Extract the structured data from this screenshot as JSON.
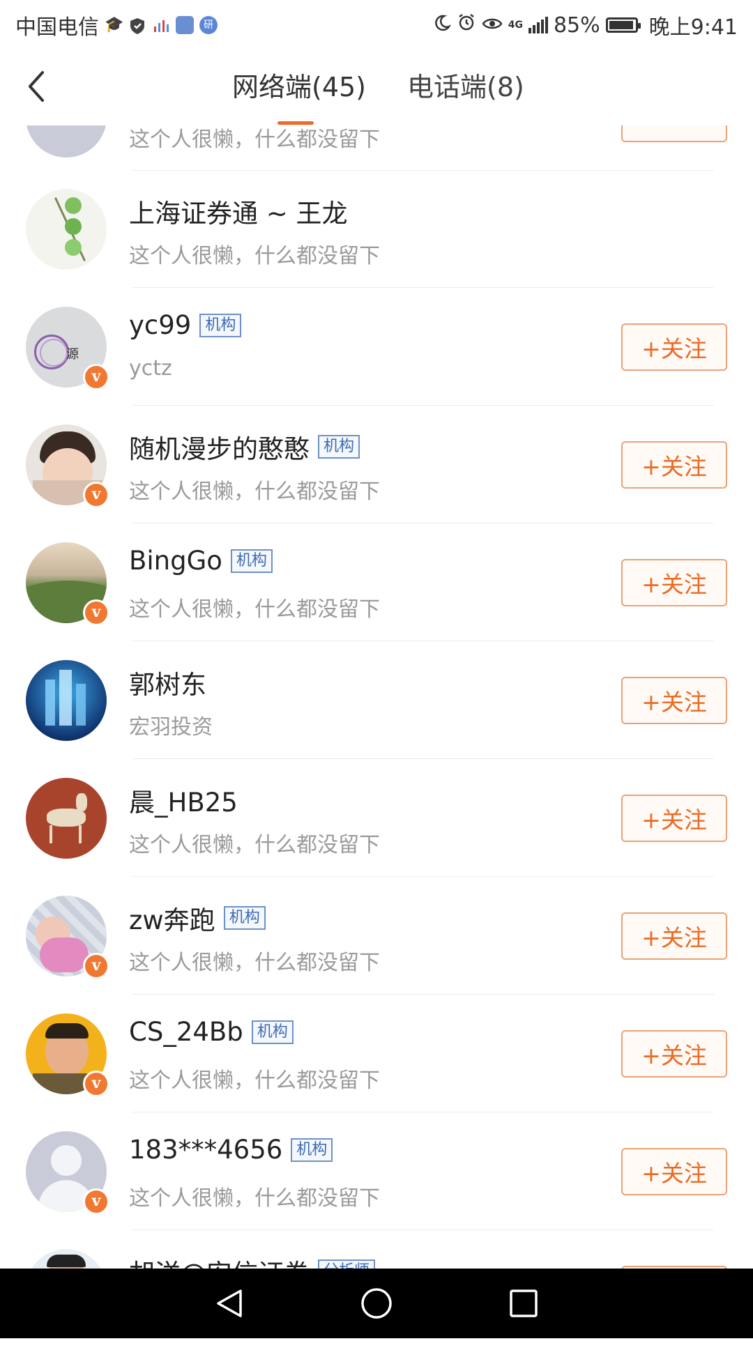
{
  "status_bar": {
    "carrier": "中国电信",
    "battery": "85%",
    "time": "晚上9:41",
    "network": "4G",
    "icons": [
      "graduation-cap-icon",
      "shield-icon",
      "chart-icon",
      "stock-icon",
      "research-icon",
      "moon-icon",
      "alarm-icon",
      "eye-icon",
      "signal-icon",
      "battery-icon"
    ]
  },
  "header": {
    "back_icon": "back-arrow-icon",
    "tabs": [
      {
        "label": "网络端(45)",
        "active": true
      },
      {
        "label": "电话端(8)",
        "active": false
      }
    ],
    "accent_color": "#f0692a"
  },
  "list": {
    "follow_label": "+关注",
    "items": [
      {
        "name": "",
        "tag": "",
        "desc": "这个人很懒，什么都没留下",
        "verified": false,
        "follow": true,
        "avatar": "default-avatar"
      },
      {
        "name": "上海证券通 ~ 王龙",
        "tag": "",
        "desc": "这个人很懒，什么都没留下",
        "verified": false,
        "follow": false,
        "avatar": "plant-avatar"
      },
      {
        "name": "yc99",
        "tag": "机构",
        "desc": "yctz",
        "verified": true,
        "follow": true,
        "avatar": "logo-avatar"
      },
      {
        "name": "随机漫步的憨憨",
        "tag": "机构",
        "desc": "这个人很懒，什么都没留下",
        "verified": true,
        "follow": true,
        "avatar": "child-avatar"
      },
      {
        "name": "BingGo",
        "tag": "机构",
        "desc": "这个人很懒，什么都没留下",
        "verified": true,
        "follow": true,
        "avatar": "landscape-avatar"
      },
      {
        "name": "郭树东",
        "tag": "",
        "desc": "宏羽投资",
        "verified": false,
        "follow": true,
        "avatar": "city-avatar"
      },
      {
        "name": "晨_HB25",
        "tag": "",
        "desc": "这个人很懒，什么都没留下",
        "verified": false,
        "follow": true,
        "avatar": "art-avatar"
      },
      {
        "name": "zw奔跑",
        "tag": "机构",
        "desc": "这个人很懒，什么都没留下",
        "verified": true,
        "follow": true,
        "avatar": "baby-avatar"
      },
      {
        "name": "CS_24Bb",
        "tag": "机构",
        "desc": "这个人很懒，什么都没留下",
        "verified": true,
        "follow": true,
        "avatar": "man-avatar"
      },
      {
        "name": "183***4656",
        "tag": "机构",
        "desc": "这个人很懒，什么都没留下",
        "verified": true,
        "follow": true,
        "avatar": "default-avatar"
      },
      {
        "name": "胡洋@安信证券",
        "tag": "分析师",
        "desc": "",
        "verified": false,
        "follow": true,
        "avatar": "man-avatar"
      }
    ]
  },
  "navbar": {
    "buttons": [
      "back-triangle-icon",
      "home-circle-icon",
      "recents-square-icon"
    ]
  }
}
